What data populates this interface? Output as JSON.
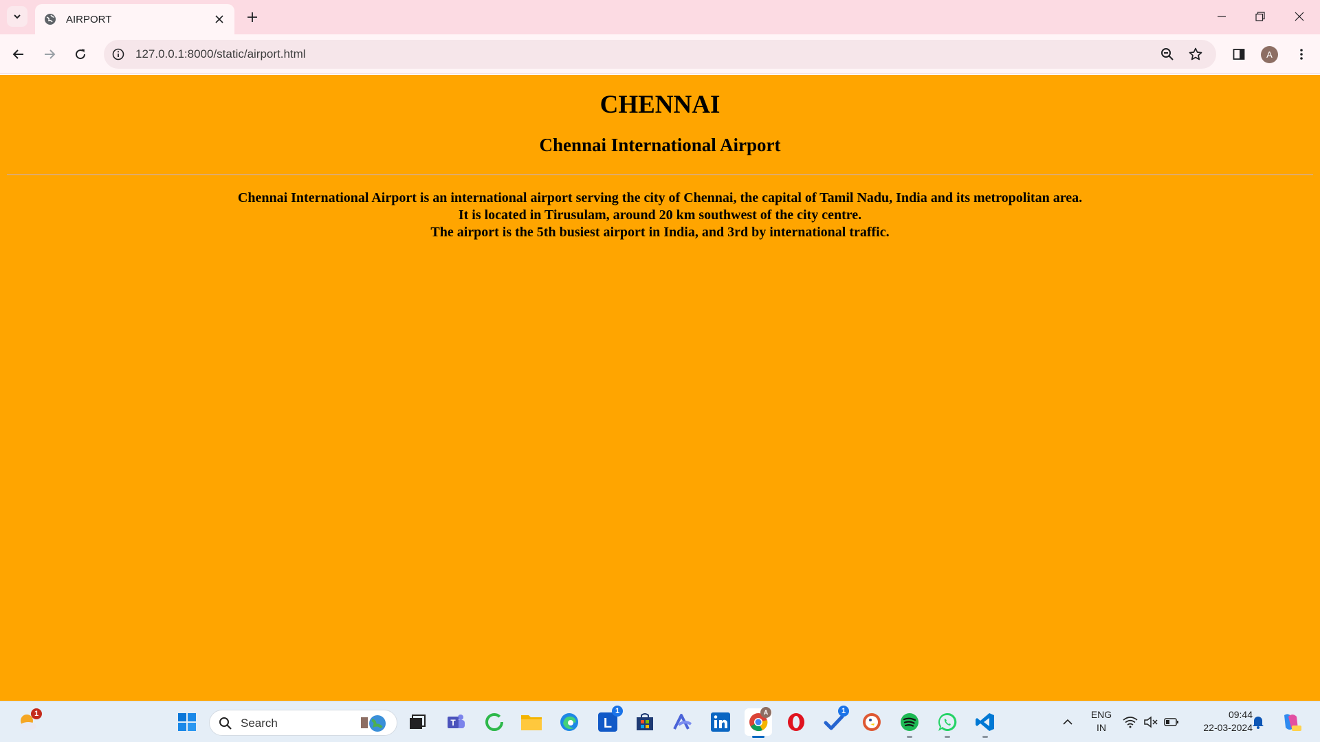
{
  "browser": {
    "tab_title": "AIRPORT",
    "url": "127.0.0.1:8000/static/airport.html",
    "profile_initial": "A"
  },
  "page": {
    "background": "#ffa500",
    "heading": "CHENNAI",
    "subheading": "Chennai International Airport",
    "lines": [
      "Chennai International Airport is an international airport serving the city of Chennai, the capital of Tamil Nadu, India and its metropolitan area.",
      "It is located in Tirusulam, around 20 km southwest of the city centre.",
      "The airport is the 5th busiest airport in India, and 3rd by international traffic."
    ]
  },
  "taskbar": {
    "search_placeholder": "Search",
    "weather_badge": "1",
    "l_app_badge": "1",
    "todo_badge": "1",
    "language_line1": "ENG",
    "language_line2": "IN",
    "time": "09:44",
    "date": "22-03-2024",
    "icons": [
      "weather-icon",
      "start-icon",
      "search-icon",
      "task-view-icon",
      "teams-icon",
      "refresh-app-icon",
      "file-explorer-icon",
      "edge-icon",
      "l-app-icon",
      "store-icon",
      "arc-icon",
      "linkedin-icon",
      "chrome-icon",
      "opera-icon",
      "todo-icon",
      "duckduckgo-icon",
      "spotify-icon",
      "whatsapp-icon",
      "vscode-icon"
    ]
  }
}
